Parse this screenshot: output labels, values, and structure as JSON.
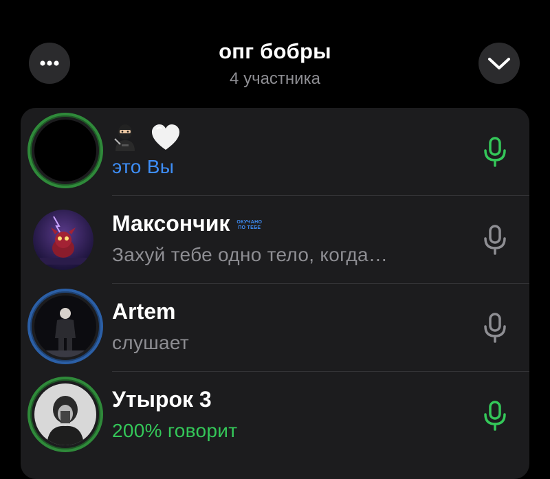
{
  "header": {
    "title": "опг бобры",
    "subtitle": "4 участника",
    "more_icon": "ellipsis-icon",
    "collapse_icon": "chevron-down-icon"
  },
  "participants": [
    {
      "name_emojis": [
        "ninja",
        "white-heart"
      ],
      "status": "это Вы",
      "status_color": "#3e8ef7",
      "mic_state": "active",
      "ring": "green"
    },
    {
      "name": "Максончик",
      "badge_line1": "ОКУЧАНО",
      "badge_line2": "ПО ТЕБЕ",
      "status": "Захуй тебе одно тело, когда…",
      "mic_state": "muted",
      "ring": "none"
    },
    {
      "name": "Artem",
      "status": "слушает",
      "mic_state": "muted",
      "ring": "blue"
    },
    {
      "name": "Утырок 3",
      "status": "200% говорит",
      "status_color": "#34c759",
      "mic_state": "active",
      "ring": "green"
    }
  ],
  "colors": {
    "background": "#000000",
    "panel": "#1c1c1e",
    "accent_blue": "#3e8ef7",
    "speaking_green": "#34c759",
    "muted_gray": "#8e8e93"
  }
}
